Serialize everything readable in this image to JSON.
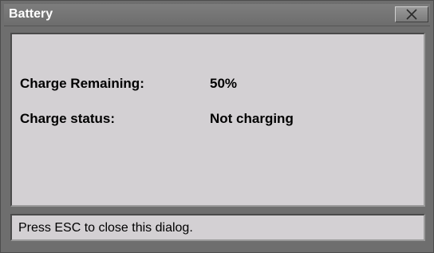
{
  "window": {
    "title": "Battery",
    "close_icon": "close-icon"
  },
  "battery": {
    "charge_remaining_label": "Charge Remaining:",
    "charge_remaining_value": "50%",
    "charge_status_label": "Charge status:",
    "charge_status_value": "Not charging"
  },
  "status_bar": {
    "text": "Press ESC to close this dialog."
  },
  "colors": {
    "frame": "#6e6e6e",
    "panel": "#d3d0d3",
    "title_text": "#ffffff"
  }
}
